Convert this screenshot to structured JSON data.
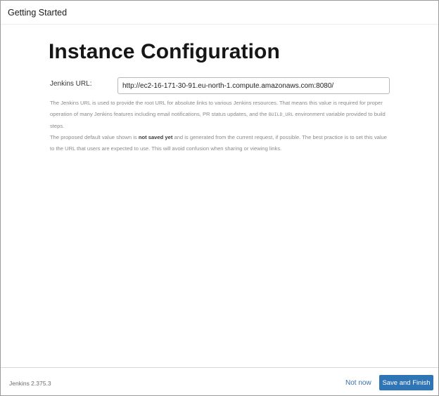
{
  "header": {
    "title": "Getting Started"
  },
  "main": {
    "title": "Instance Configuration",
    "url_label": "Jenkins URL:",
    "url_value": "http://ec2-16-171-30-91.eu-north-1.compute.amazonaws.com:8080/",
    "help": {
      "p1_before_code": "The Jenkins URL is used to provide the root URL for absolute links to various Jenkins resources. That means this value is required for proper operation of many Jenkins features including email notifications, PR status updates, and the ",
      "p1_code": "BUILD_URL",
      "p1_after_code": " environment variable provided to build steps.",
      "p2_before_bold": "The proposed default value shown is ",
      "p2_bold": "not saved yet",
      "p2_after_bold": " and is generated from the current request, if possible. The best practice is to set this value to the URL that users are expected to use. This will avoid confusion when sharing or viewing links."
    }
  },
  "footer": {
    "version": "Jenkins 2.375.3",
    "not_now_label": "Not now",
    "save_finish_label": "Save and Finish"
  },
  "colors": {
    "primary_button": "#2f74b5",
    "link": "#3b6ea5"
  }
}
